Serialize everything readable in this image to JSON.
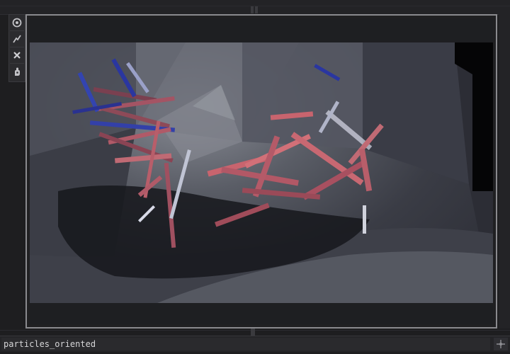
{
  "toolbar": {
    "buttons": [
      {
        "name": "target-icon"
      },
      {
        "name": "lightning-icon"
      },
      {
        "name": "close-icon"
      },
      {
        "name": "pan-hand-icon"
      }
    ]
  },
  "viewer": {
    "content": "3d-render-viewport"
  },
  "name_bar": {
    "node_name": "particles_oriented",
    "pin_icon": "crosshair-icon"
  },
  "colors": {
    "frame_border": "#8a8a8e",
    "background": "#1e1e20",
    "particle_pink": "#c8646e",
    "particle_blue": "#3040b0"
  }
}
